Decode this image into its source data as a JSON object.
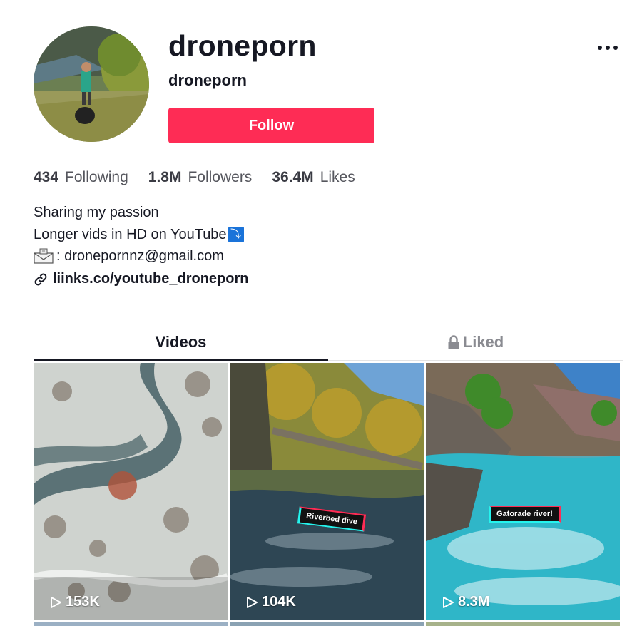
{
  "profile": {
    "username": "droneporn",
    "nickname": "droneporn",
    "follow_label": "Follow"
  },
  "stats": [
    {
      "value": "434",
      "label": "Following"
    },
    {
      "value": "1.8M",
      "label": "Followers"
    },
    {
      "value": "36.4M",
      "label": "Likes"
    }
  ],
  "bio": {
    "line1": "Sharing my passion",
    "line2": "Longer vids in HD on YouTube",
    "line2_icon": "down-arrow-icon",
    "line3": ": dronepornnz@gmail.com",
    "line3_icon": "envelope-icon"
  },
  "link": {
    "text": "liinks.co/youtube_droneporn",
    "icon": "link-icon"
  },
  "tabs": [
    {
      "label": "Videos",
      "active": true
    },
    {
      "label": "Liked",
      "active": false,
      "icon": "lock-icon"
    }
  ],
  "videos": [
    {
      "views": "153K",
      "caption": ""
    },
    {
      "views": "104K",
      "caption": "Riverbed dive"
    },
    {
      "views": "8.3M",
      "caption": "Gatorade river!"
    }
  ],
  "colors": {
    "accent": "#fe2c55",
    "text": "#161823",
    "muted": "#8a8b91"
  }
}
